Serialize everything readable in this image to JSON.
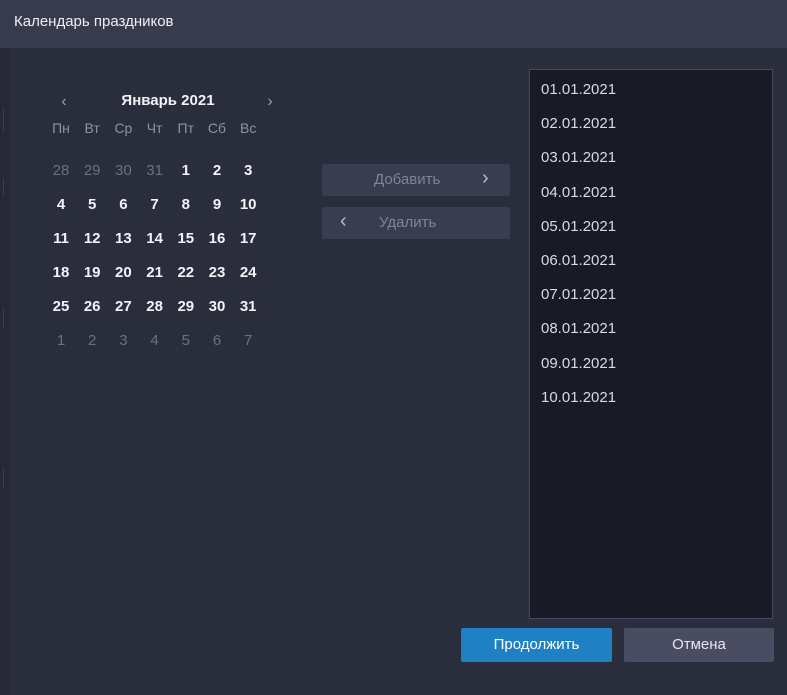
{
  "window": {
    "title": "Календарь праздников"
  },
  "calendar": {
    "month_label": "Январь 2021",
    "prev_icon": "chevron-left-icon",
    "next_icon": "chevron-right-icon",
    "weekdays": [
      "Пн",
      "Вт",
      "Ср",
      "Чт",
      "Пт",
      "Сб",
      "Вс"
    ],
    "weeks": [
      [
        "28",
        "29",
        "30",
        "31",
        "1",
        "2",
        "3"
      ],
      [
        "4",
        "5",
        "6",
        "7",
        "8",
        "9",
        "10"
      ],
      [
        "11",
        "12",
        "13",
        "14",
        "15",
        "16",
        "17"
      ],
      [
        "18",
        "19",
        "20",
        "21",
        "22",
        "23",
        "24"
      ],
      [
        "25",
        "26",
        "27",
        "28",
        "29",
        "30",
        "31"
      ],
      [
        "1",
        "2",
        "3",
        "4",
        "5",
        "6",
        "7"
      ]
    ]
  },
  "actions": {
    "add_label": "Добавить",
    "remove_label": "Удалить"
  },
  "holidays": [
    "01.01.2021",
    "02.01.2021",
    "03.01.2021",
    "04.01.2021",
    "05.01.2021",
    "06.01.2021",
    "07.01.2021",
    "08.01.2021",
    "09.01.2021",
    "10.01.2021"
  ],
  "footer": {
    "continue_label": "Продолжить",
    "cancel_label": "Отмена"
  },
  "colors": {
    "accent": "#1f80c4",
    "background": "#2a2d3c",
    "list_background": "#181a26"
  }
}
